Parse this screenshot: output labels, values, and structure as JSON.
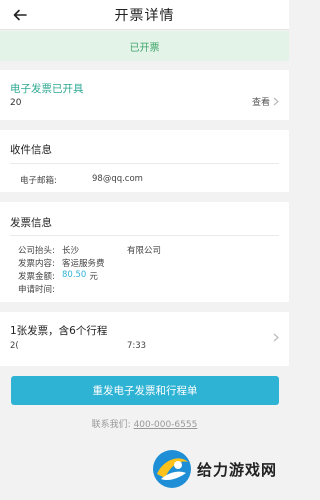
{
  "header": {
    "title": "开票详情"
  },
  "status": {
    "text": "已开票"
  },
  "invoice": {
    "title": "电子发票已开具",
    "number": "20",
    "view_label": "查看"
  },
  "recipient": {
    "section_title": "收件信息",
    "email_label": "电子邮箱:",
    "email_value": "98@qq.com"
  },
  "invoice_info": {
    "section_title": "发票信息",
    "company_label": "公司抬头:",
    "company_value_part1": "长沙",
    "company_value_part2": "有限公司",
    "content_label": "发票内容:",
    "content_value": "客运服务费",
    "amount_label": "发票金额:",
    "amount_value": "80.50",
    "amount_unit": "元",
    "apply_time_label": "申请时间:"
  },
  "trip": {
    "summary": "1张发票，含6个行程",
    "date": "2(",
    "time": "7:33"
  },
  "actions": {
    "resend_label": "重发电子发票和行程单"
  },
  "contact": {
    "label": "联系我们:",
    "phone": "400-000-6555"
  },
  "watermark": {
    "text": "给力游戏网"
  },
  "colors": {
    "accent": "#2fb3d4",
    "teal": "#2fa893",
    "status_bg": "#e4f3e8",
    "status_text": "#3fa66a"
  }
}
